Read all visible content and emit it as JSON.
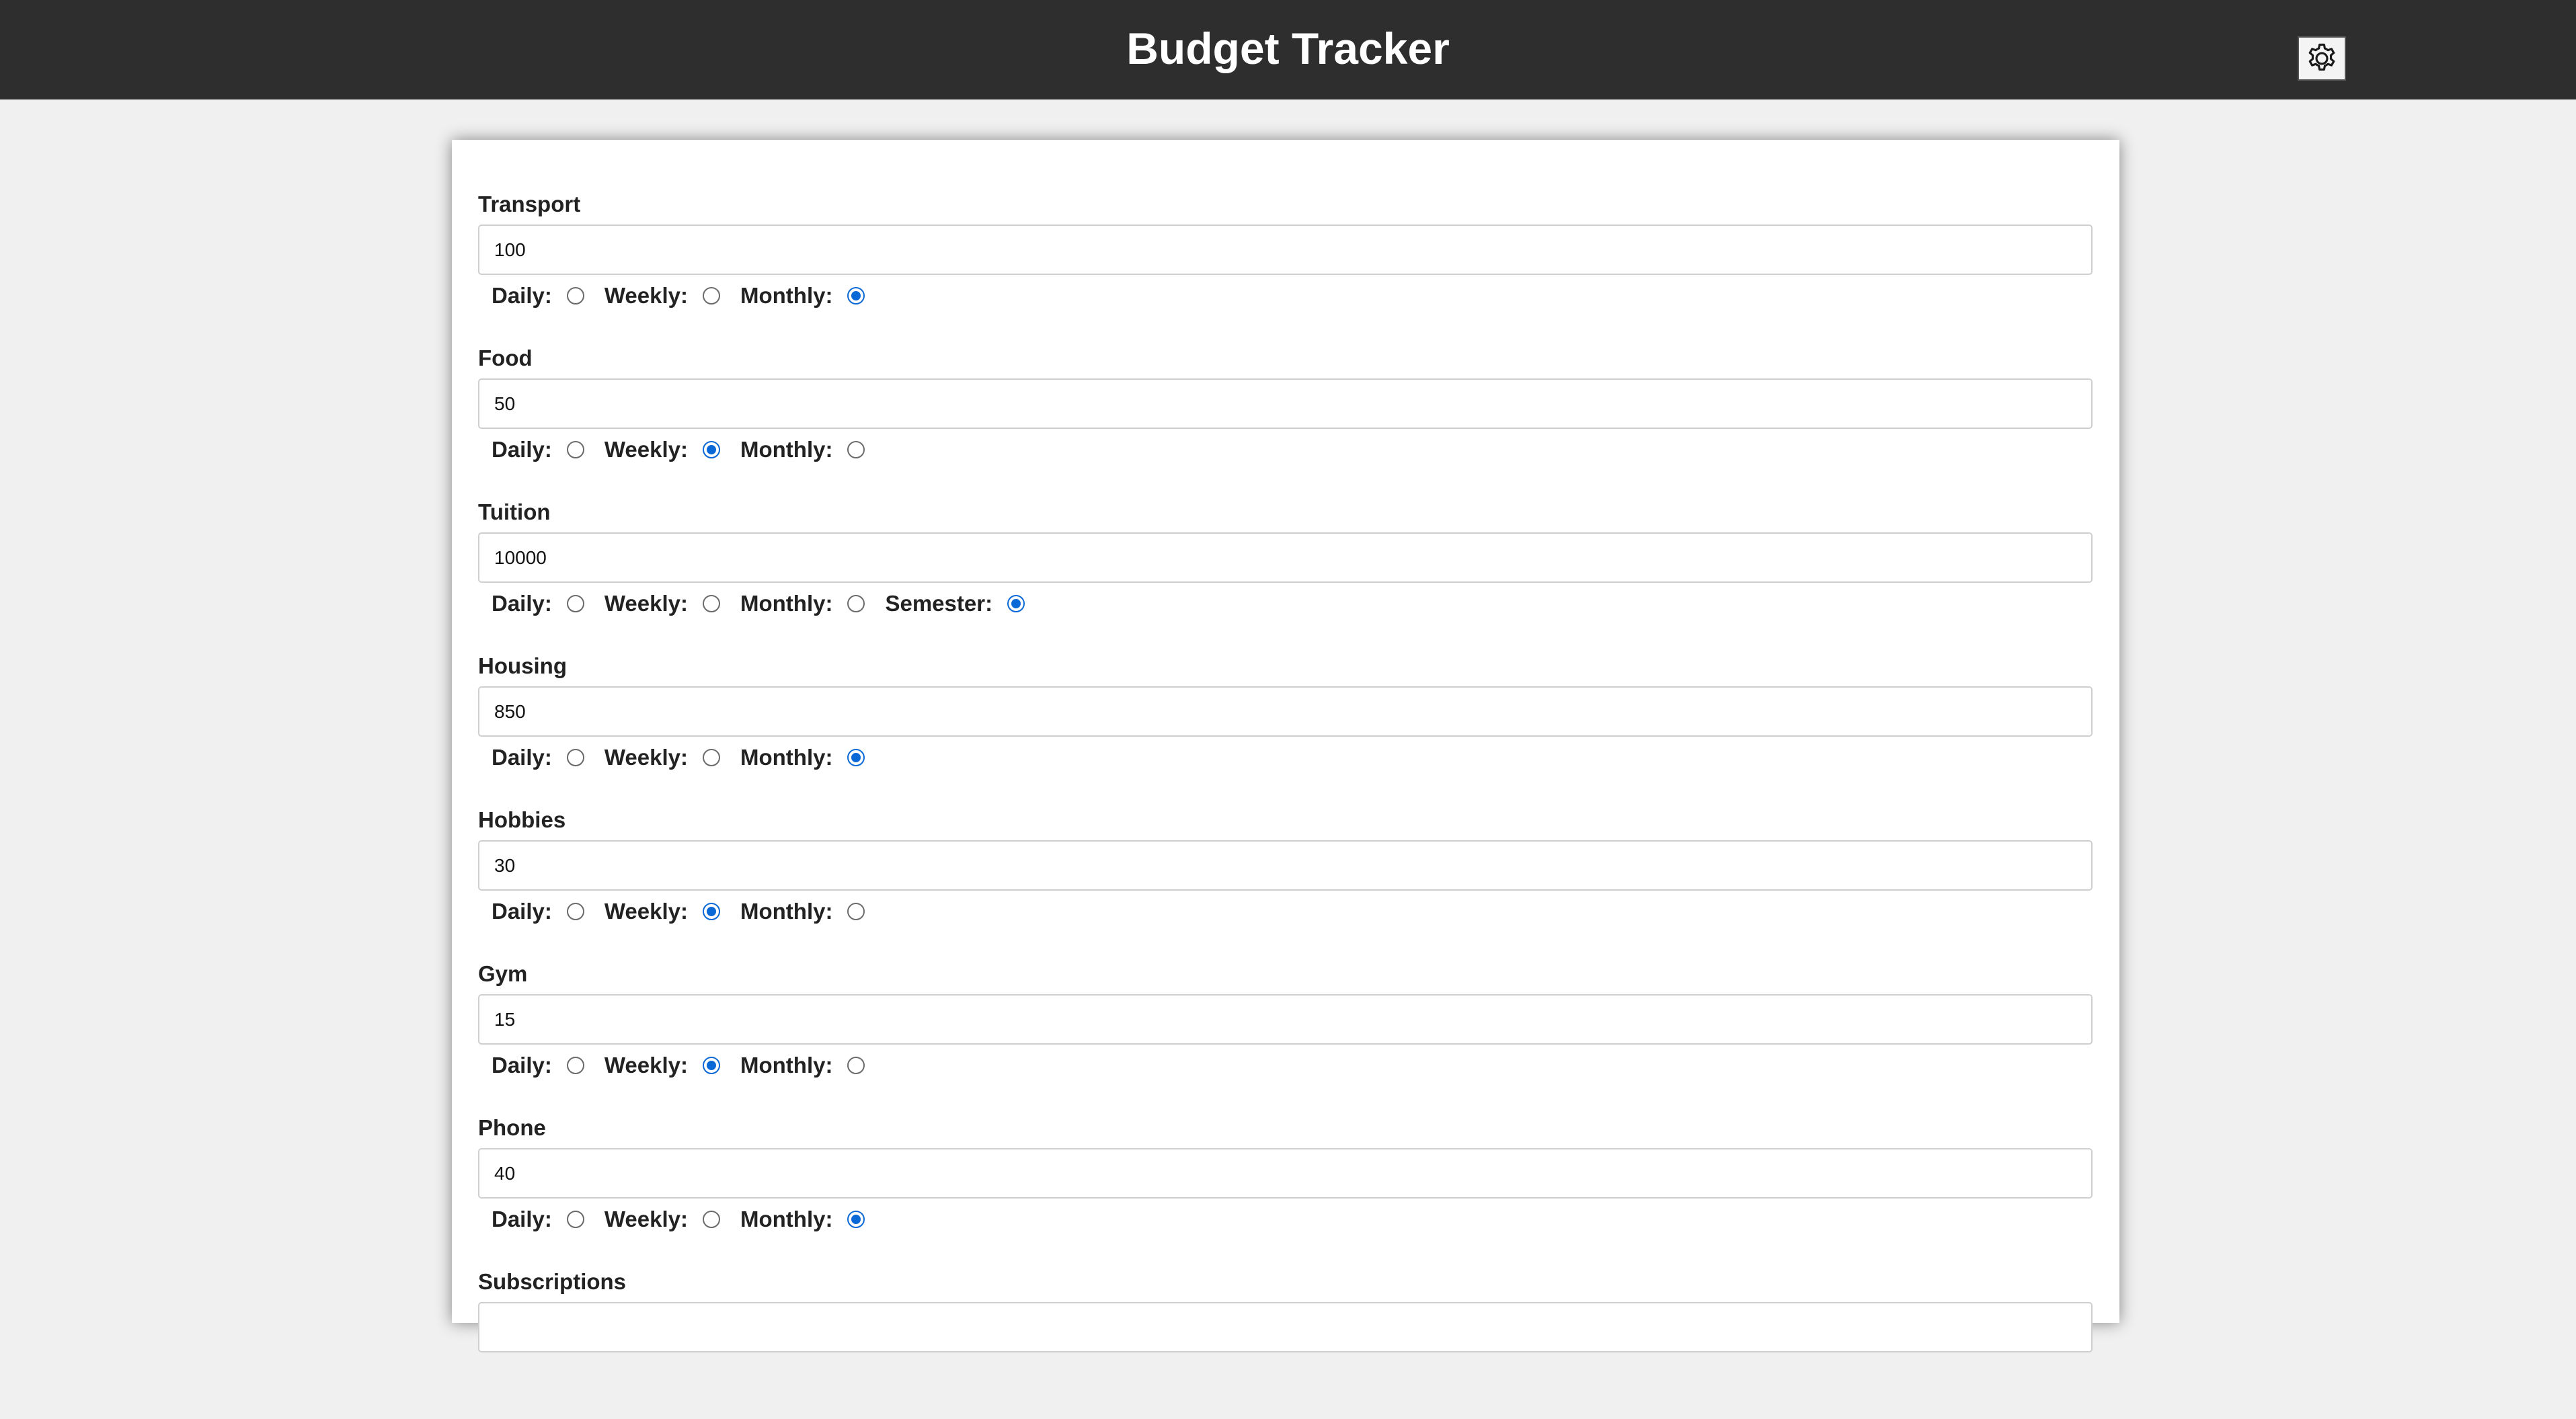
{
  "header": {
    "title": "Budget Tracker",
    "settings_icon": "gear-icon",
    "background_color": "#2e2e2e"
  },
  "accent_color": "#0a69d6",
  "categories": [
    {
      "name": "Transport",
      "value": "100",
      "options": [
        {
          "label": "Daily:",
          "checked": false
        },
        {
          "label": "Weekly:",
          "checked": false
        },
        {
          "label": "Monthly:",
          "checked": true
        }
      ]
    },
    {
      "name": "Food",
      "value": "50",
      "options": [
        {
          "label": "Daily:",
          "checked": false
        },
        {
          "label": "Weekly:",
          "checked": true
        },
        {
          "label": "Monthly:",
          "checked": false
        }
      ]
    },
    {
      "name": "Tuition",
      "value": "10000",
      "options": [
        {
          "label": "Daily:",
          "checked": false
        },
        {
          "label": "Weekly:",
          "checked": false
        },
        {
          "label": "Monthly:",
          "checked": false
        },
        {
          "label": "Semester:",
          "checked": true
        }
      ]
    },
    {
      "name": "Housing",
      "value": "850",
      "options": [
        {
          "label": "Daily:",
          "checked": false
        },
        {
          "label": "Weekly:",
          "checked": false
        },
        {
          "label": "Monthly:",
          "checked": true
        }
      ]
    },
    {
      "name": "Hobbies",
      "value": "30",
      "options": [
        {
          "label": "Daily:",
          "checked": false
        },
        {
          "label": "Weekly:",
          "checked": true
        },
        {
          "label": "Monthly:",
          "checked": false
        }
      ]
    },
    {
      "name": "Gym",
      "value": "15",
      "options": [
        {
          "label": "Daily:",
          "checked": false
        },
        {
          "label": "Weekly:",
          "checked": true
        },
        {
          "label": "Monthly:",
          "checked": false
        }
      ]
    },
    {
      "name": "Phone",
      "value": "40",
      "options": [
        {
          "label": "Daily:",
          "checked": false
        },
        {
          "label": "Weekly:",
          "checked": false
        },
        {
          "label": "Monthly:",
          "checked": true
        }
      ]
    },
    {
      "name": "Subscriptions",
      "value": "",
      "options": []
    }
  ]
}
